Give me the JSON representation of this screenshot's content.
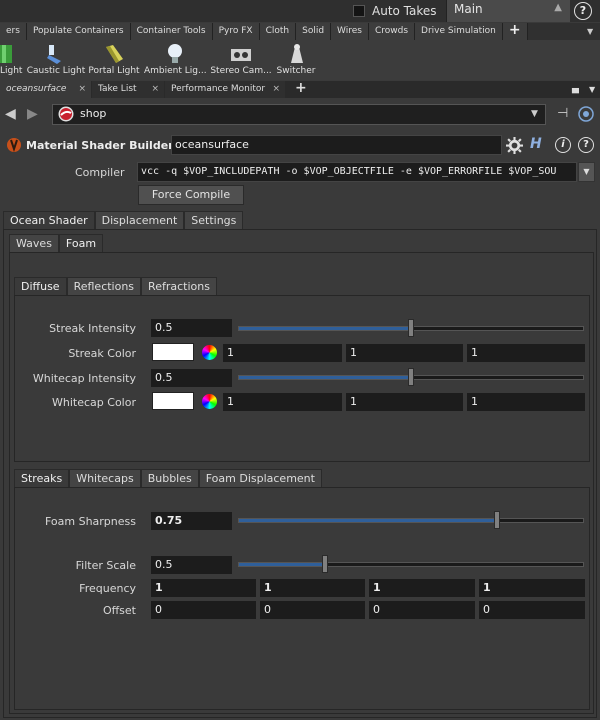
{
  "topbar": {
    "auto_takes_label": "Auto Takes",
    "take_value": "Main",
    "help": "?"
  },
  "shelf_tabs": [
    "ers",
    "Populate Containers",
    "Container Tools",
    "Pyro FX",
    "Cloth",
    "Solid",
    "Wires",
    "Crowds",
    "Drive Simulation"
  ],
  "shelf_plus": "+",
  "shelf_tools": [
    {
      "label": "Light",
      "icon": "light-icon"
    },
    {
      "label": "Caustic Light",
      "icon": "caustic-light-icon"
    },
    {
      "label": "Portal Light",
      "icon": "portal-light-icon"
    },
    {
      "label": "Ambient Lig...",
      "icon": "ambient-light-icon"
    },
    {
      "label": "Stereo Cam...",
      "icon": "stereo-camera-icon"
    },
    {
      "label": "Switcher",
      "icon": "switcher-icon"
    }
  ],
  "pane_tabs": [
    {
      "label": "oceansurface",
      "close": "×"
    },
    {
      "label": "Take List",
      "close": "×"
    },
    {
      "label": "Performance Monitor",
      "close": "×"
    }
  ],
  "pane_plus": "+",
  "path": {
    "value": "shop"
  },
  "node": {
    "type": "Material Shader Builder",
    "name": "oceansurface"
  },
  "compiler": {
    "label": "Compiler",
    "value": "vcc -q $VOP_INCLUDEPATH -o $VOP_OBJECTFILE -e $VOP_ERRORFILE $VOP_SOU",
    "force_compile": "Force Compile"
  },
  "main_tabs": [
    "Ocean Shader",
    "Displacement",
    "Settings"
  ],
  "sub_tabs": [
    "Waves",
    "Foam"
  ],
  "foam_tabs_1": [
    "Diffuse",
    "Reflections",
    "Refractions"
  ],
  "diffuse": {
    "streak_intensity": {
      "label": "Streak Intensity",
      "value": "0.5",
      "slider": 0.5
    },
    "streak_color": {
      "label": "Streak Color",
      "r": "1",
      "g": "1",
      "b": "1",
      "swatch": "#ffffff"
    },
    "whitecap_intensity": {
      "label": "Whitecap Intensity",
      "value": "0.5",
      "slider": 0.5
    },
    "whitecap_color": {
      "label": "Whitecap Color",
      "r": "1",
      "g": "1",
      "b": "1",
      "swatch": "#ffffff"
    }
  },
  "foam_tabs_2": [
    "Streaks",
    "Whitecaps",
    "Bubbles",
    "Foam Displacement"
  ],
  "streaks": {
    "foam_sharpness": {
      "label": "Foam Sharpness",
      "value": "0.75",
      "slider": 0.75
    },
    "filter_scale": {
      "label": "Filter Scale",
      "value": "0.5",
      "slider": 0.25
    },
    "frequency": {
      "label": "Frequency",
      "values": [
        "1",
        "1",
        "1",
        "1"
      ]
    },
    "offset": {
      "label": "Offset",
      "values": [
        "0",
        "0",
        "0",
        "0"
      ]
    }
  }
}
